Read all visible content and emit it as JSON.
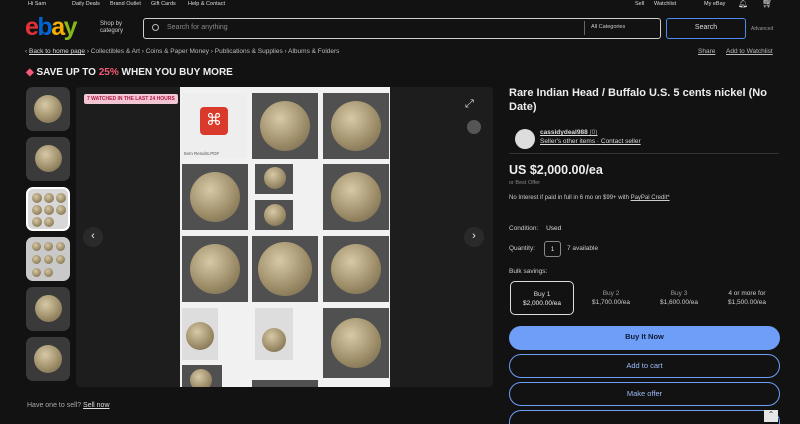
{
  "topbar": {
    "greeting": "Hi Sam",
    "daily_deals": "Daily Deals",
    "brand_outlet": "Brand Outlet",
    "gift_cards": "Gift Cards",
    "help": "Help & Contact",
    "sell": "Sell",
    "watchlist": "Watchlist",
    "my_ebay": "My eBay"
  },
  "header": {
    "logo": "ebay",
    "shop_by_category": "Shop by category",
    "search_placeholder": "Search for anything",
    "category_select": "All Categories",
    "search_button": "Search",
    "advanced": "Advanced"
  },
  "breadcrumb": {
    "back": "Back to home page",
    "items": [
      "Collectibles & Art",
      "Coins & Paper Money",
      "Publications & Supplies",
      "Albums & Folders"
    ],
    "share": "Share",
    "add_to_watchlist": "Add to Watchlist"
  },
  "promo": {
    "prefix": "SAVE UP TO ",
    "percent": "25%",
    "suffix": " WHEN YOU BUY MORE"
  },
  "gallery": {
    "badge": "7 WATCHED IN THE LAST 24 HOURS",
    "pdf_caption": "Item Results.PDF"
  },
  "footer": {
    "question": "Have one to sell?",
    "link": "Sell now"
  },
  "item": {
    "title": "Rare Indian Head / Buffalo U.S. 5 cents nickel (No Date)",
    "seller_name": "cassidydeal988",
    "seller_score": "(0)",
    "seller_other": "Seller's other items",
    "contact_seller": "Contact seller",
    "price": "US $2,000.00/ea",
    "best_offer": "or Best Offer",
    "credit_text": "No Interest if paid in full in 6 mo on $99+ with ",
    "credit_link": "PayPal Credit*",
    "condition_label": "Condition:",
    "condition_value": "Used",
    "quantity_label": "Quantity:",
    "quantity_value": "1",
    "available": "7 available",
    "bulk_label": "Bulk savings:",
    "tiers": [
      {
        "label": "Buy 1",
        "price": "$2,000.00/ea"
      },
      {
        "label": "Buy 2",
        "price": "$1,700.00/ea"
      },
      {
        "label": "Buy 3",
        "price": "$1,600.00/ea"
      },
      {
        "label": "4 or more for",
        "price": "$1,500.00/ea"
      }
    ],
    "buy_now": "Buy It Now",
    "add_to_cart": "Add to cart",
    "make_offer": "Make offer"
  },
  "colors": {
    "accent": "#6e9ef8",
    "promo": "#f25a78",
    "background": "#121212"
  },
  "icons": [
    "chevron-down-icon",
    "bell-icon",
    "cart-icon",
    "search-icon",
    "expand-icon",
    "chevron-left-icon",
    "chevron-right-icon",
    "pdf-icon",
    "chevron-up-icon"
  ]
}
